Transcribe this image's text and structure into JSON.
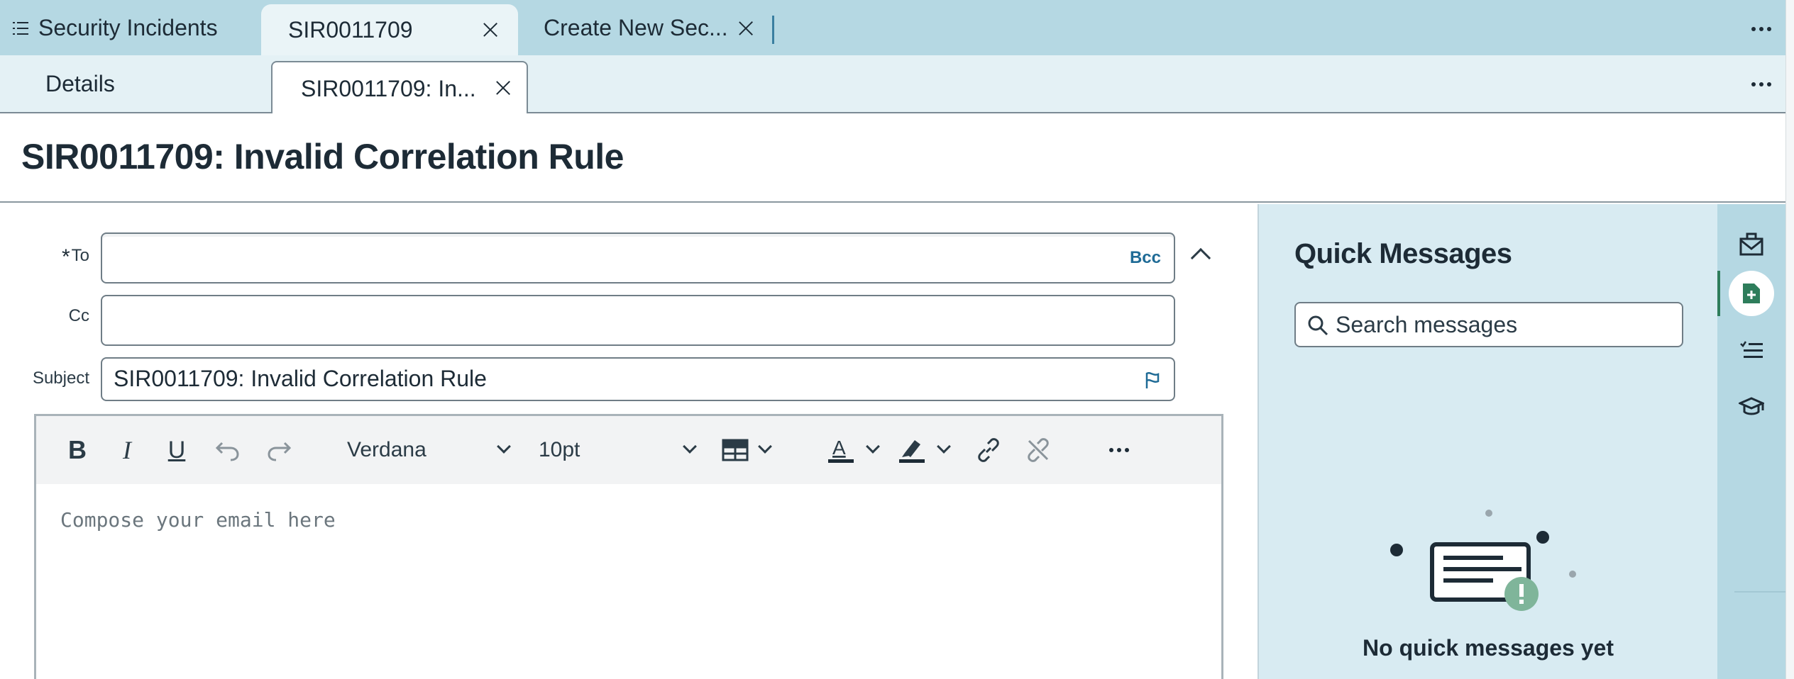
{
  "top_tabs": {
    "list_tab_label": "Security Incidents",
    "record_tab_label": "SIR0011709",
    "new_tab_label": "Create New Sec..."
  },
  "sub_tabs": {
    "details_label": "Details",
    "email_tab_label": "SIR0011709: In..."
  },
  "page": {
    "title": "SIR0011709: Invalid Correlation Rule"
  },
  "email_form": {
    "to_label": "To",
    "to_required_mark": "*",
    "to_value": "",
    "bcc_label": "Bcc",
    "cc_label": "Cc",
    "cc_value": "",
    "subject_label": "Subject",
    "subject_value": "SIR0011709: Invalid Correlation Rule"
  },
  "editor": {
    "bold_label": "B",
    "italic_label": "I",
    "underline_label": "U",
    "font_family": "Verdana",
    "font_size": "10pt",
    "placeholder": "Compose your email here"
  },
  "quick_messages": {
    "title": "Quick Messages",
    "search_placeholder": "Search messages",
    "empty_text": "No quick messages yet"
  },
  "colors": {
    "tab_bar": "#b5d8e3",
    "sub_tab_bar": "#e4f1f5",
    "panel_bg": "#d8ebf2",
    "accent_link": "#1f6b96",
    "accent_green": "#2e7d5b",
    "illustration_badge": "#7fb59a"
  },
  "icons": {
    "list": "list-icon",
    "close": "close-icon",
    "more": "more-options-icon",
    "collapse": "chevron-up-icon",
    "flag": "flag-icon",
    "search": "search-icon",
    "rail": [
      "email-icon",
      "new-document-icon",
      "checklist-icon",
      "graduation-cap-icon"
    ]
  }
}
